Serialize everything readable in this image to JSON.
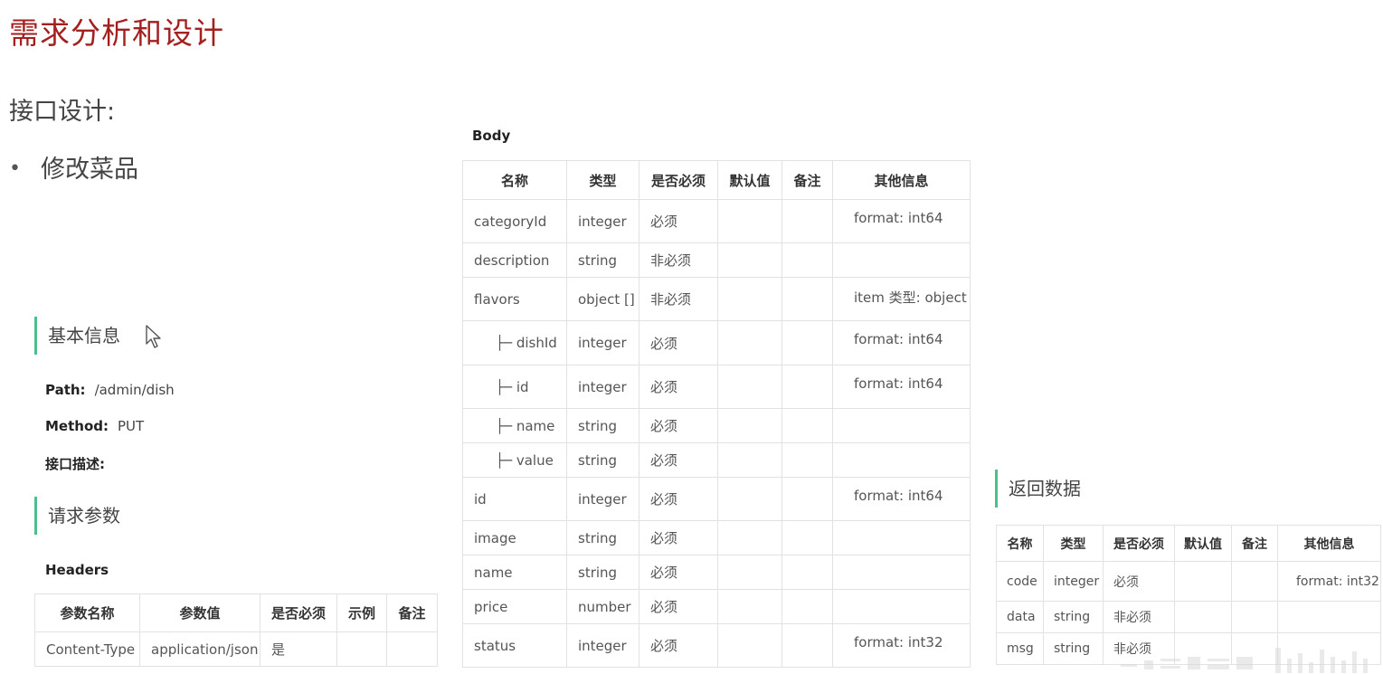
{
  "page": {
    "title": "需求分析和设计",
    "subtitle": "接口设计:",
    "bullet": "修改菜品"
  },
  "basic": {
    "heading": "基本信息",
    "path_label": "Path:",
    "path_value": "/admin/dish",
    "method_label": "Method:",
    "method_value": "PUT",
    "desc_label": "接口描述:"
  },
  "request": {
    "heading": "请求参数",
    "headers_label": "Headers",
    "columns": [
      "参数名称",
      "参数值",
      "是否必须",
      "示例",
      "备注"
    ],
    "rows": [
      [
        "Content-Type",
        "application/json",
        "是",
        "",
        ""
      ]
    ]
  },
  "body": {
    "label": "Body",
    "columns": [
      "名称",
      "类型",
      "是否必须",
      "默认值",
      "备注",
      "其他信息"
    ],
    "rows": [
      {
        "name": "categoryId",
        "type": "integer",
        "required": "必须",
        "default": "",
        "note": "",
        "other": "format: int64",
        "child": false
      },
      {
        "name": "description",
        "type": "string",
        "required": "非必须",
        "default": "",
        "note": "",
        "other": "",
        "child": false
      },
      {
        "name": "flavors",
        "type": "object []",
        "required": "非必须",
        "default": "",
        "note": "",
        "other": "item 类型: object",
        "child": false
      },
      {
        "name": "├─ dishId",
        "type": "integer",
        "required": "必须",
        "default": "",
        "note": "",
        "other": "format: int64",
        "child": true
      },
      {
        "name": "├─ id",
        "type": "integer",
        "required": "必须",
        "default": "",
        "note": "",
        "other": "format: int64",
        "child": true
      },
      {
        "name": "├─ name",
        "type": "string",
        "required": "必须",
        "default": "",
        "note": "",
        "other": "",
        "child": true
      },
      {
        "name": "├─ value",
        "type": "string",
        "required": "必须",
        "default": "",
        "note": "",
        "other": "",
        "child": true
      },
      {
        "name": "id",
        "type": "integer",
        "required": "必须",
        "default": "",
        "note": "",
        "other": "format: int64",
        "child": false
      },
      {
        "name": "image",
        "type": "string",
        "required": "必须",
        "default": "",
        "note": "",
        "other": "",
        "child": false
      },
      {
        "name": "name",
        "type": "string",
        "required": "必须",
        "default": "",
        "note": "",
        "other": "",
        "child": false
      },
      {
        "name": "price",
        "type": "number",
        "required": "必须",
        "default": "",
        "note": "",
        "other": "",
        "child": false
      },
      {
        "name": "status",
        "type": "integer",
        "required": "必须",
        "default": "",
        "note": "",
        "other": "format: int32",
        "child": false
      }
    ]
  },
  "response": {
    "heading": "返回数据",
    "columns": [
      "名称",
      "类型",
      "是否必须",
      "默认值",
      "备注",
      "其他信息"
    ],
    "rows": [
      {
        "name": "code",
        "type": "integer",
        "required": "必须",
        "default": "",
        "note": "",
        "other": "format: int32"
      },
      {
        "name": "data",
        "type": "string",
        "required": "非必须",
        "default": "",
        "note": "",
        "other": ""
      },
      {
        "name": "msg",
        "type": "string",
        "required": "非必须",
        "default": "",
        "note": "",
        "other": ""
      }
    ]
  },
  "colors": {
    "title": "#a3201f",
    "accent_bar": "#4bc08d",
    "table_border": "#e2e2e2"
  },
  "icons": [
    "mouse-pointer-icon",
    "watermark-logo"
  ]
}
